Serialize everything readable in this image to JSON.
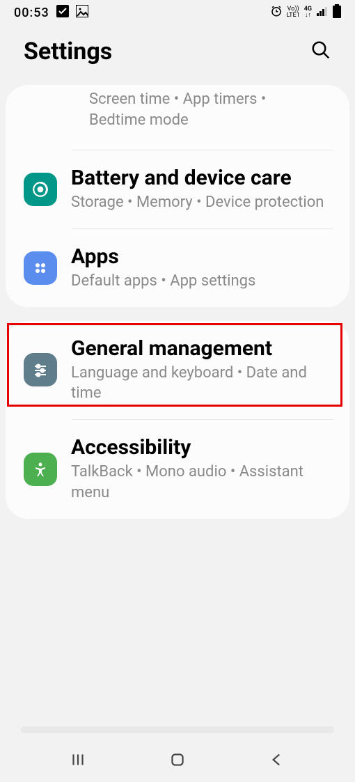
{
  "status": {
    "time": "00:53",
    "net_label": "Vo))",
    "lte_label": "LTE1",
    "net_gen": "4G"
  },
  "header": {
    "title": "Settings"
  },
  "cards": [
    {
      "rows": [
        {
          "sub": "Screen time  •  App timers  •  Bedtime mode"
        },
        {
          "title": "Battery and device care",
          "sub": "Storage  •  Memory  •  Device protection"
        },
        {
          "title": "Apps",
          "sub": "Default apps  •  App settings",
          "highlighted": true
        }
      ]
    },
    {
      "rows": [
        {
          "title": "General management",
          "sub": "Language and keyboard  •  Date and time"
        },
        {
          "title": "Accessibility",
          "sub": "TalkBack  •  Mono audio  •  Assistant menu"
        }
      ]
    }
  ]
}
